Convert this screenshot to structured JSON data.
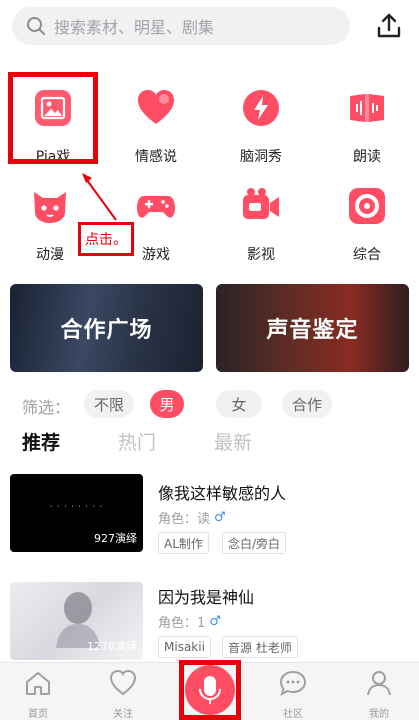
{
  "search": {
    "placeholder": "搜索素材、明星、剧集"
  },
  "categories": [
    {
      "label": "Pia戏",
      "icon": "image-icon"
    },
    {
      "label": "情感说",
      "icon": "heart-icon"
    },
    {
      "label": "脑洞秀",
      "icon": "lightning-icon"
    },
    {
      "label": "朗读",
      "icon": "book-icon"
    },
    {
      "label": "动漫",
      "icon": "cat-icon"
    },
    {
      "label": "游戏",
      "icon": "gamepad-icon"
    },
    {
      "label": "影视",
      "icon": "video-camera-icon"
    },
    {
      "label": "综合",
      "icon": "disc-icon"
    }
  ],
  "annotation": {
    "text": "点击。"
  },
  "banners": [
    {
      "label": "合作广场"
    },
    {
      "label": "声音鉴定"
    }
  ],
  "filter": {
    "label": "筛选：",
    "options": [
      "不限",
      "男",
      "女",
      "合作"
    ],
    "selected": "男"
  },
  "tabs": [
    "推荐",
    "热门",
    "最新"
  ],
  "active_tab": "推荐",
  "items": [
    {
      "title": "像我这样敏感的人",
      "role": "角色：读",
      "gender": "♂",
      "count": "927演绎",
      "tags": [
        "AL制作",
        "念白/旁白"
      ]
    },
    {
      "title": "因为我是神仙",
      "role": "角色：1",
      "gender": "♂",
      "count": "1278演绎",
      "tags": [
        "Misakii",
        "音源 杜老师"
      ]
    }
  ],
  "bottom_nav": [
    {
      "label": "首页",
      "icon": "home-icon"
    },
    {
      "label": "关注",
      "icon": "heart-outline-icon"
    },
    {
      "label": "",
      "icon": "microphone-icon"
    },
    {
      "label": "社区",
      "icon": "chat-icon"
    },
    {
      "label": "我的",
      "icon": "profile-icon"
    }
  ],
  "colors": {
    "accent": "#ff4d63",
    "highlight": "#e8000b",
    "gender_male": "#3b8ef2"
  }
}
